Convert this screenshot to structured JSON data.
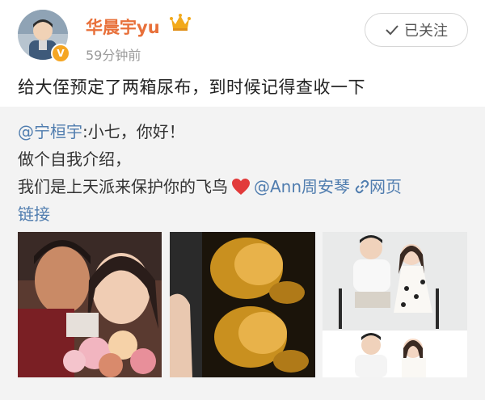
{
  "author": {
    "name": "华晨宇yu",
    "time": "59分钟前",
    "follow_label": "已关注"
  },
  "post": {
    "text": "给大侄预定了两箱尿布，到时候记得查收一下"
  },
  "repost": {
    "mention": "@宁桓宇",
    "greeting": ":小七，你好！",
    "line2": "做个自我介绍，",
    "line3": "我们是上天派来保护你的飞鸟",
    "mention2": "@Ann周安琴",
    "link_label": "网页",
    "link_label2": "链接"
  },
  "colors": {
    "name": "#e8703a",
    "link": "#507daf",
    "repost_bg": "#f3f3f3"
  },
  "icons": [
    "crown-icon",
    "verified-icon",
    "check-icon",
    "heart-icon",
    "link-icon"
  ]
}
